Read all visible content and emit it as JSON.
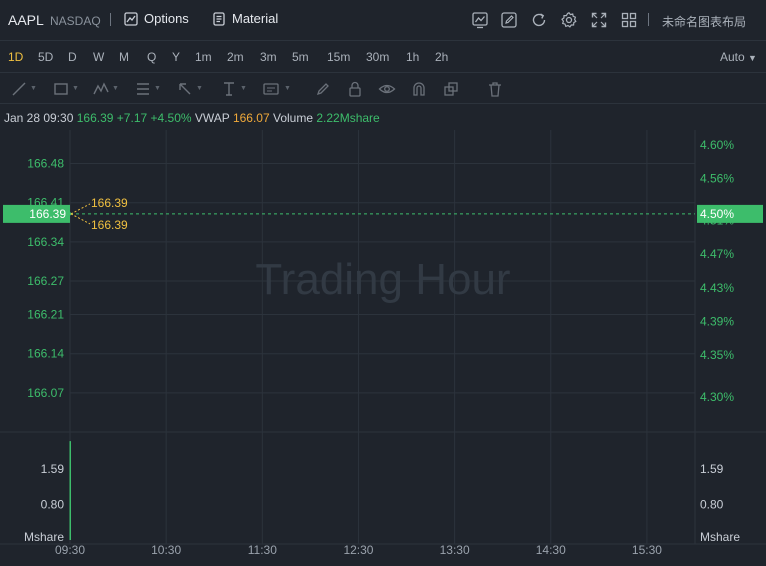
{
  "header": {
    "symbol": "AAPL",
    "exchange": "NASDAQ",
    "options_label": "Options",
    "material_label": "Material",
    "layout_name": "未命名图表布局",
    "icons": [
      "chart-style-icon",
      "pencil-icon",
      "refresh-icon",
      "settings-icon",
      "fullscreen-icon",
      "grid-layout-icon"
    ]
  },
  "periods": {
    "items": [
      "1D",
      "5D",
      "D",
      "W",
      "M",
      "Q",
      "Y",
      "1m",
      "2m",
      "3m",
      "5m",
      "15m",
      "30m",
      "1h",
      "2h"
    ],
    "active": "1D",
    "scale_mode": "Auto"
  },
  "drawing_tools": [
    "line-tool-icon",
    "rect-tool-icon",
    "pattern-tool-icon",
    "fib-tool-icon",
    "arrow-tool-icon",
    "text-tool-icon",
    "annotation-tool-icon",
    "brush-icon",
    "lock-icon",
    "eye-icon",
    "magnet-icon",
    "layers-icon",
    "trash-icon"
  ],
  "info": {
    "time": "Jan 28 09:30",
    "price": "166.39",
    "change": "+7.17",
    "change_pct": "+4.50%",
    "vwap_label": "VWAP",
    "vwap_value": "166.07",
    "volume_label": "Volume",
    "volume_value": "2.22Mshare"
  },
  "colors": {
    "up": "#3dbd6b",
    "vwap": "#f0a93a",
    "marker": "#f0c040",
    "background": "#1f242c",
    "grid": "#2c333c"
  },
  "chart_data": {
    "type": "line",
    "watermark": "Trading Hour",
    "price_axis": {
      "ticks": [
        166.07,
        166.14,
        166.21,
        166.27,
        166.34,
        166.41,
        166.48
      ],
      "labels": [
        "166.07",
        "166.14",
        "166.21",
        "166.27",
        "166.34",
        "166.41",
        "166.48"
      ],
      "range": [
        166.0,
        166.54
      ]
    },
    "percent_axis": {
      "labels": [
        "4.30%",
        "4.35%",
        "4.39%",
        "4.43%",
        "4.47%",
        "4.51%",
        "4.56%",
        "4.60%"
      ],
      "values": [
        4.3,
        4.35,
        4.39,
        4.43,
        4.47,
        4.51,
        4.56,
        4.6
      ]
    },
    "current_price": 166.39,
    "current_price_label": "166.39",
    "current_pct_label": "4.50%",
    "high_label": "166.39",
    "low_label": "166.39",
    "series": [
      {
        "x": [
          "09:30"
        ],
        "y": [
          166.39
        ]
      }
    ],
    "volume": {
      "unit_label": "Mshare",
      "ticks": [
        0.8,
        1.59
      ],
      "tick_labels": [
        "0.80",
        "1.59"
      ],
      "range": [
        0,
        2.2
      ],
      "bars": [
        {
          "x": "09:30",
          "value": 2.22
        }
      ]
    },
    "x_axis": {
      "labels": [
        "09:30",
        "10:30",
        "11:30",
        "12:30",
        "13:30",
        "14:30",
        "15:30"
      ],
      "minutes": [
        0,
        60,
        120,
        180,
        240,
        300,
        360
      ],
      "range_minutes": [
        0,
        390
      ]
    }
  }
}
